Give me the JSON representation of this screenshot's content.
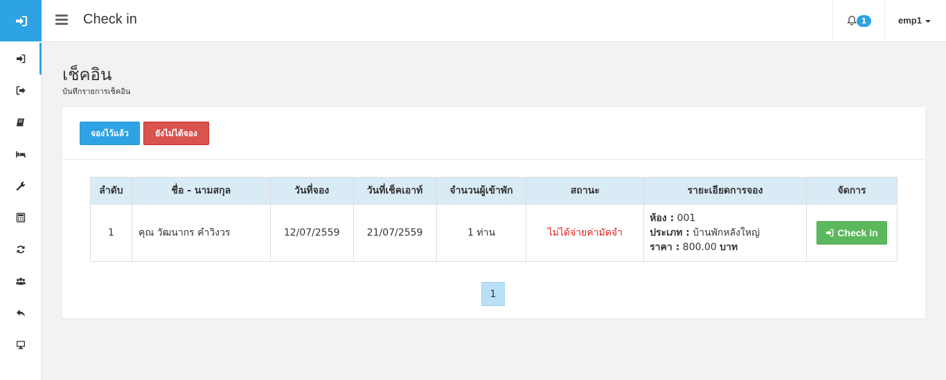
{
  "topbar": {
    "title": "Check in",
    "notification_count": "1",
    "user": "emp1"
  },
  "sidebar": {
    "items": [
      {
        "icon": "sign-in-icon"
      },
      {
        "icon": "sign-out-icon"
      },
      {
        "icon": "book-icon"
      },
      {
        "icon": "bed-icon"
      },
      {
        "icon": "wrench-icon"
      },
      {
        "icon": "calculator-icon"
      },
      {
        "icon": "refresh-icon"
      },
      {
        "icon": "users-icon"
      },
      {
        "icon": "reply-icon"
      },
      {
        "icon": "desktop-icon"
      }
    ]
  },
  "page": {
    "title": "เช็คอิน",
    "subtitle": "บันทึกรายการเช็คอิน"
  },
  "buttons": {
    "booked": "จองไว้แล้ว",
    "not_booked": "ยังไม่ได้จอง"
  },
  "table": {
    "headers": [
      "ลำดับ",
      "ชื่อ - นามสกุล",
      "วันที่จอง",
      "วันที่เช็คเอาท์",
      "จำนวนผู้เข้าพัก",
      "สถานะ",
      "รายะเอียดการจอง",
      "จัดการ"
    ],
    "rows": [
      {
        "no": "1",
        "name": "คุณ วัฒนากร คำวิงวร",
        "booking_date": "12/07/2559",
        "checkout_date": "21/07/2559",
        "guests": "1 ท่าน",
        "status": "ไม่ได้จ่ายค่ามัดจำ",
        "room_label": "ห้อง :",
        "room_value": "001",
        "type_label": "ประเภท :",
        "type_value": "บ้านพักหลังใหญ่",
        "price_label": "ราคา :",
        "price_value": "800.00",
        "price_unit": "บาท",
        "action": "Check in"
      }
    ]
  },
  "pagination": {
    "current": "1"
  },
  "colors": {
    "accent": "#2ea3e3",
    "danger": "#d9534f",
    "success": "#5cb85c",
    "status_text": "#e02020"
  }
}
